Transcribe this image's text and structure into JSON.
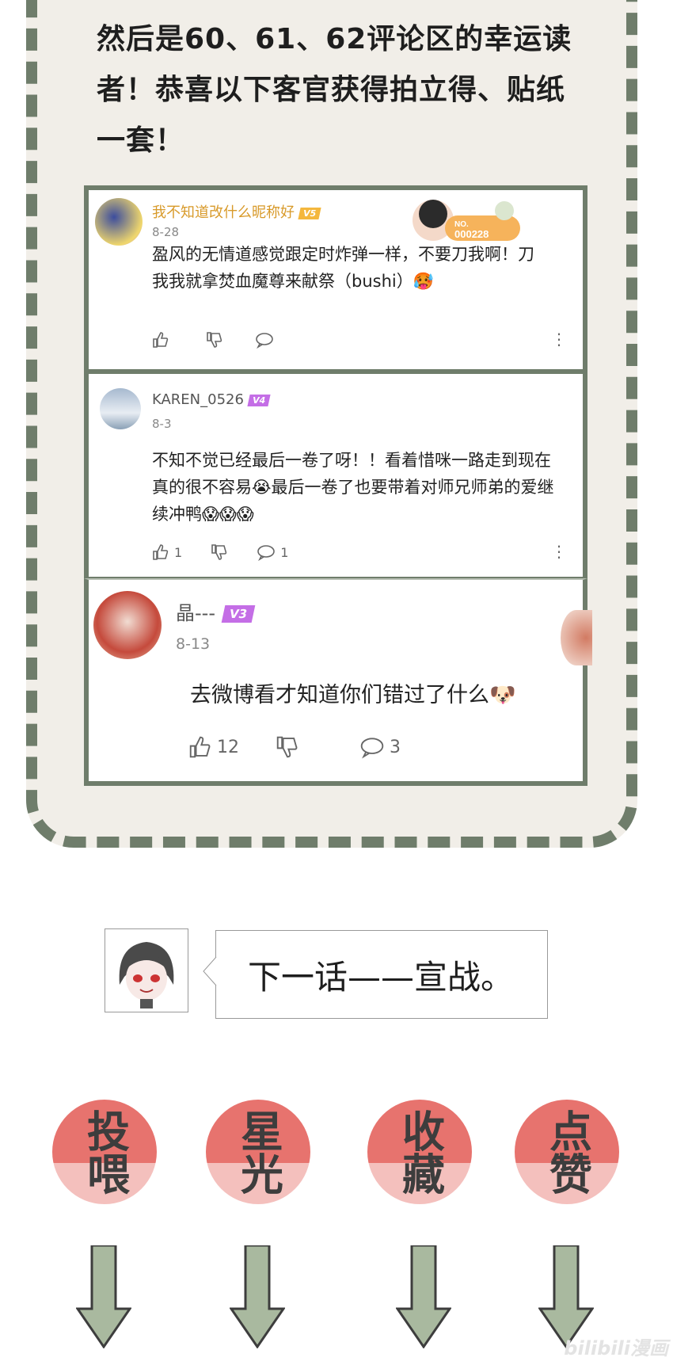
{
  "intro": {
    "text": "然后是60、61、62评论区的幸运读者！恭喜以下客官获得拍立得、贴纸一套！"
  },
  "comments": [
    {
      "username": "我不知道改什么昵称好",
      "level": "V5",
      "level_color": "#f4b73d",
      "name_color": "#d89a2a",
      "date": "8-28",
      "body": "盈风的无情道感觉跟定时炸弹一样，不要刀我啊！刀我我就拿焚血魔尊来献祭（bushi）🥵",
      "badge": {
        "prefix": "NO.",
        "number": "000228"
      },
      "likes": "",
      "replies": ""
    },
    {
      "username": "KAREN_0526",
      "level": "V4",
      "level_color": "#c46ee6",
      "name_color": "#555555",
      "date": "8-3",
      "body": "不知不觉已经最后一卷了呀！！看着惜咪一路走到现在真的很不容易😭最后一卷了也要带着对师兄师弟的爱继续冲鸭😱😱😱",
      "likes": "1",
      "replies": "1"
    },
    {
      "username": "晶---",
      "level": "V3",
      "level_color": "#c46ee6",
      "name_color": "#555555",
      "date": "8-13",
      "body": "去微博看才知道你们错过了什么🐶",
      "likes": "12",
      "replies": "3"
    }
  ],
  "next_episode": {
    "text": "下一话——宣战。"
  },
  "calls_to_action": [
    {
      "label": "投喂"
    },
    {
      "label": "星光"
    },
    {
      "label": "收藏"
    },
    {
      "label": "点赞"
    }
  ],
  "watermark": "bilibili漫画",
  "colors": {
    "frame": "#6f7d6b",
    "panel_bg": "#f1eee8",
    "arrow": "#a9b99f",
    "seal": "#e35a55"
  }
}
